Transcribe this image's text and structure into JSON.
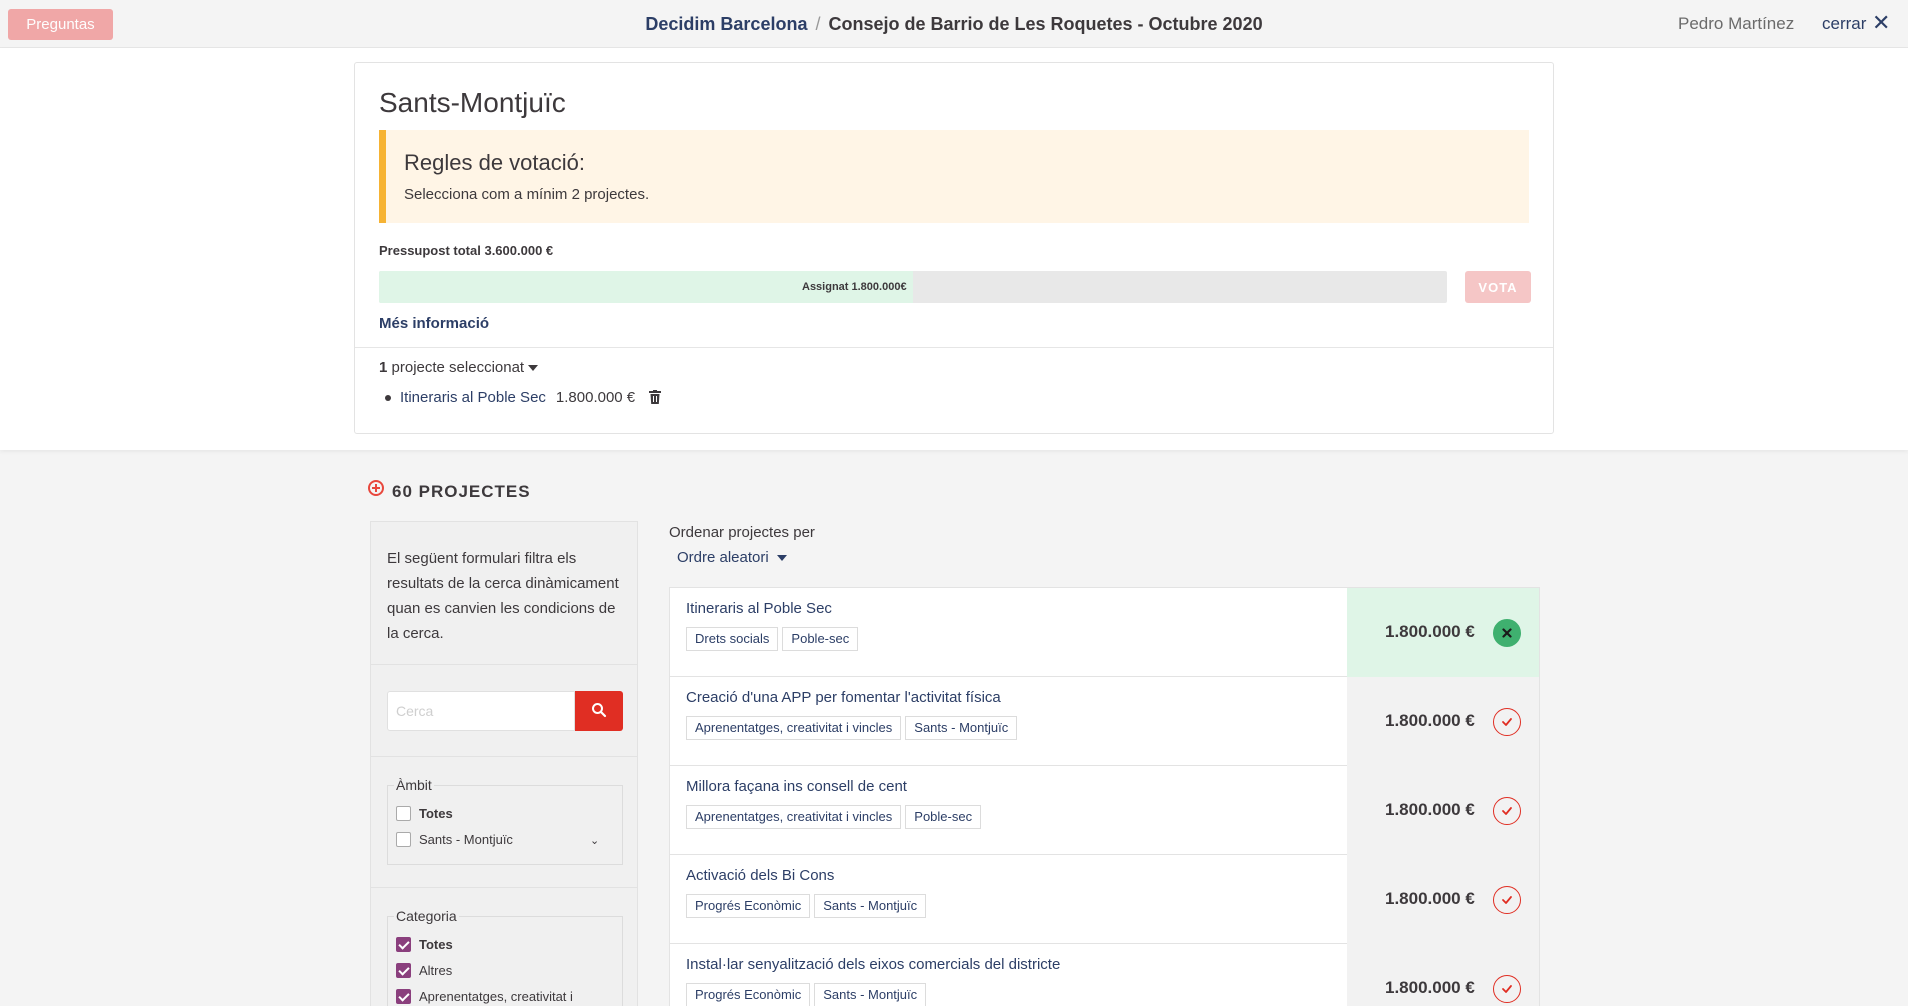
{
  "topbar": {
    "questions_label": "Preguntas",
    "org": "Decidim Barcelona",
    "separator": "/",
    "process": "Consejo de Barrio de Les Roquetes - Octubre 2020",
    "user": "Pedro Martínez",
    "close_label": "cerrar"
  },
  "budget": {
    "title": "Sants-Montjuïc",
    "rules_title": "Regles de votació:",
    "rules_text": "Selecciona com a mínim 2 projectes.",
    "total_label": "Pressupost total 3.600.000 €",
    "assigned_label": "Assignat 1.800.000€",
    "assigned_fraction": 0.5,
    "vote_label": "VOTA",
    "more_info": "Més informació",
    "selected_count": "1",
    "selected_label": "projecte seleccionat",
    "selected_items": [
      {
        "title": "Itineraris al Poble Sec",
        "price": "1.800.000 €"
      }
    ]
  },
  "projects": {
    "heading": "60 PROJECTES"
  },
  "filter": {
    "intro": "El següent formulari filtra els resultats de la cerca dinàmicament quan es canvien les condicions de la cerca.",
    "search_placeholder": "Cerca",
    "scope": {
      "legend": "Àmbit",
      "options": [
        {
          "label": "Totes",
          "checked": false
        },
        {
          "label": "Sants - Montjuïc",
          "checked": false
        }
      ]
    },
    "category": {
      "legend": "Categoria",
      "options": [
        {
          "label": "Totes",
          "checked": true
        },
        {
          "label": "Altres",
          "checked": true
        },
        {
          "label": "Aprenentatges, creativitat i",
          "checked": true
        }
      ]
    }
  },
  "sort": {
    "label": "Ordenar projectes per",
    "value": "Ordre aleatori"
  },
  "list": [
    {
      "title": "Itineraris al Poble Sec",
      "tags": [
        "Drets socials",
        "Poble-sec"
      ],
      "price": "1.800.000 €",
      "added": true
    },
    {
      "title": "Creació d'una APP per fomentar l'activitat física",
      "tags": [
        "Aprenentatges, creativitat i vincles",
        "Sants - Montjuïc"
      ],
      "price": "1.800.000 €",
      "added": false
    },
    {
      "title": "Millora façana ins consell de cent",
      "tags": [
        "Aprenentatges, creativitat i vincles",
        "Poble-sec"
      ],
      "price": "1.800.000 €",
      "added": false
    },
    {
      "title": "Activació dels Bi Cons",
      "tags": [
        "Progrés Econòmic",
        "Sants - Montjuïc"
      ],
      "price": "1.800.000 €",
      "added": false
    },
    {
      "title": "Instal·lar senyalització dels eixos comercials del districte",
      "tags": [
        "Progrés Econòmic",
        "Sants - Montjuïc"
      ],
      "price": "1.800.000 €",
      "added": false
    }
  ],
  "colors": {
    "primary": "#e02e23",
    "secondary": "#2c3e66",
    "success": "#3fb06f",
    "warning": "#f6b334",
    "checkbox": "#8a3f7d"
  }
}
